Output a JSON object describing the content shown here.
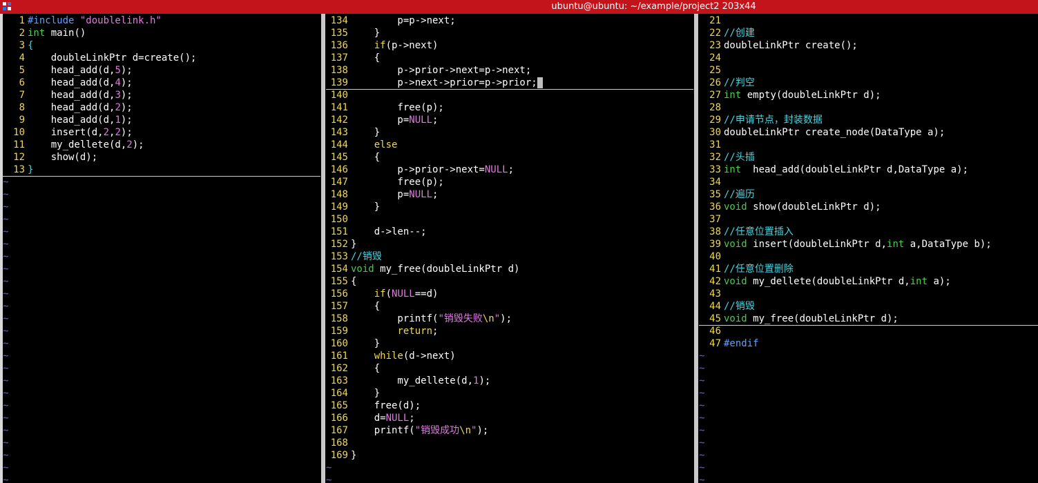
{
  "window": {
    "title": "ubuntu@ubuntu: ~/example/project2 203x44"
  },
  "colors": {
    "titlebar": "#c4141b",
    "background": "#000000",
    "line_number": "#f0d84e",
    "tilde": "#5f5ff0",
    "default": "#ffffff",
    "preproc": "#5fa0ff",
    "type": "#4ecb4e",
    "constant": "#e07be0",
    "statement": "#f0d84e",
    "comment": "#47d5e0",
    "operator": "#ffffff"
  },
  "panes": [
    {
      "name": "main-c",
      "lines": [
        {
          "n": "1",
          "segs": [
            {
              "t": "#include ",
              "c": "preproc"
            },
            {
              "t": "\"doublelink.h\"",
              "c": "constant"
            }
          ]
        },
        {
          "n": "2",
          "segs": [
            {
              "t": "int",
              "c": "type"
            },
            {
              "t": " main()",
              "c": "default"
            }
          ]
        },
        {
          "n": "3",
          "segs": [
            {
              "t": "{",
              "c": "comment"
            }
          ]
        },
        {
          "n": "4",
          "segs": [
            {
              "t": "    doubleLinkPtr d=create();",
              "c": "default"
            }
          ]
        },
        {
          "n": "5",
          "segs": [
            {
              "t": "    head_add(d,",
              "c": "default"
            },
            {
              "t": "5",
              "c": "constant"
            },
            {
              "t": ");",
              "c": "default"
            }
          ]
        },
        {
          "n": "6",
          "segs": [
            {
              "t": "    head_add(d,",
              "c": "default"
            },
            {
              "t": "4",
              "c": "constant"
            },
            {
              "t": ");",
              "c": "default"
            }
          ]
        },
        {
          "n": "7",
          "segs": [
            {
              "t": "    head_add(d,",
              "c": "default"
            },
            {
              "t": "3",
              "c": "constant"
            },
            {
              "t": ");",
              "c": "default"
            }
          ]
        },
        {
          "n": "8",
          "segs": [
            {
              "t": "    head_add(d,",
              "c": "default"
            },
            {
              "t": "2",
              "c": "constant"
            },
            {
              "t": ");",
              "c": "default"
            }
          ]
        },
        {
          "n": "9",
          "segs": [
            {
              "t": "    head_add(d,",
              "c": "default"
            },
            {
              "t": "1",
              "c": "constant"
            },
            {
              "t": ");",
              "c": "default"
            }
          ]
        },
        {
          "n": "10",
          "segs": [
            {
              "t": "    insert(d,",
              "c": "default"
            },
            {
              "t": "2",
              "c": "constant"
            },
            {
              "t": ",",
              "c": "default"
            },
            {
              "t": "2",
              "c": "constant"
            },
            {
              "t": ");",
              "c": "default"
            }
          ]
        },
        {
          "n": "11",
          "segs": [
            {
              "t": "    my_dellete(d,",
              "c": "default"
            },
            {
              "t": "2",
              "c": "constant"
            },
            {
              "t": ");",
              "c": "default"
            }
          ]
        },
        {
          "n": "12",
          "segs": [
            {
              "t": "    show(d);",
              "c": "default"
            }
          ]
        },
        {
          "n": "13",
          "segs": [
            {
              "t": "}",
              "c": "comment"
            }
          ],
          "current": true
        }
      ]
    },
    {
      "name": "doublelink-c",
      "lines": [
        {
          "n": "134",
          "segs": [
            {
              "t": "        p=p->next;",
              "c": "default"
            }
          ]
        },
        {
          "n": "135",
          "segs": [
            {
              "t": "    }",
              "c": "default"
            }
          ]
        },
        {
          "n": "136",
          "segs": [
            {
              "t": "    ",
              "c": "default"
            },
            {
              "t": "if",
              "c": "statement"
            },
            {
              "t": "(p->next)",
              "c": "default"
            }
          ]
        },
        {
          "n": "137",
          "segs": [
            {
              "t": "    {",
              "c": "default"
            }
          ]
        },
        {
          "n": "138",
          "segs": [
            {
              "t": "        p->prior->next=p->next;",
              "c": "default"
            }
          ]
        },
        {
          "n": "139",
          "segs": [
            {
              "t": "        p->next->prior=p->prior;",
              "c": "default"
            }
          ],
          "current": true,
          "cursor": true
        },
        {
          "n": "140",
          "segs": []
        },
        {
          "n": "141",
          "segs": [
            {
              "t": "        free(p);",
              "c": "default"
            }
          ]
        },
        {
          "n": "142",
          "segs": [
            {
              "t": "        p=",
              "c": "default"
            },
            {
              "t": "NULL",
              "c": "constant"
            },
            {
              "t": ";",
              "c": "default"
            }
          ]
        },
        {
          "n": "143",
          "segs": [
            {
              "t": "    }",
              "c": "default"
            }
          ]
        },
        {
          "n": "144",
          "segs": [
            {
              "t": "    ",
              "c": "default"
            },
            {
              "t": "else",
              "c": "statement"
            }
          ]
        },
        {
          "n": "145",
          "segs": [
            {
              "t": "    {",
              "c": "default"
            }
          ]
        },
        {
          "n": "146",
          "segs": [
            {
              "t": "        p->prior->next=",
              "c": "default"
            },
            {
              "t": "NULL",
              "c": "constant"
            },
            {
              "t": ";",
              "c": "default"
            }
          ]
        },
        {
          "n": "147",
          "segs": [
            {
              "t": "        free(p);",
              "c": "default"
            }
          ]
        },
        {
          "n": "148",
          "segs": [
            {
              "t": "        p=",
              "c": "default"
            },
            {
              "t": "NULL",
              "c": "constant"
            },
            {
              "t": ";",
              "c": "default"
            }
          ]
        },
        {
          "n": "149",
          "segs": [
            {
              "t": "    }",
              "c": "default"
            }
          ]
        },
        {
          "n": "150",
          "segs": []
        },
        {
          "n": "151",
          "segs": [
            {
              "t": "    d->len--;",
              "c": "default"
            }
          ]
        },
        {
          "n": "152",
          "segs": [
            {
              "t": "}",
              "c": "default"
            }
          ]
        },
        {
          "n": "153",
          "segs": [
            {
              "t": "//销毁",
              "c": "comment"
            }
          ]
        },
        {
          "n": "154",
          "segs": [
            {
              "t": "void",
              "c": "type"
            },
            {
              "t": " my_free(doubleLinkPtr d)",
              "c": "default"
            }
          ]
        },
        {
          "n": "155",
          "segs": [
            {
              "t": "{",
              "c": "default"
            }
          ]
        },
        {
          "n": "156",
          "segs": [
            {
              "t": "    ",
              "c": "default"
            },
            {
              "t": "if",
              "c": "statement"
            },
            {
              "t": "(",
              "c": "default"
            },
            {
              "t": "NULL",
              "c": "constant"
            },
            {
              "t": "==d)",
              "c": "default"
            }
          ]
        },
        {
          "n": "157",
          "segs": [
            {
              "t": "    {",
              "c": "default"
            }
          ]
        },
        {
          "n": "158",
          "segs": [
            {
              "t": "        printf(",
              "c": "default"
            },
            {
              "t": "\"销毁失败",
              "c": "constant"
            },
            {
              "t": "\\n",
              "c": "statement"
            },
            {
              "t": "\"",
              "c": "constant"
            },
            {
              "t": ");",
              "c": "default"
            }
          ]
        },
        {
          "n": "159",
          "segs": [
            {
              "t": "        ",
              "c": "default"
            },
            {
              "t": "return",
              "c": "statement"
            },
            {
              "t": ";",
              "c": "default"
            }
          ]
        },
        {
          "n": "160",
          "segs": [
            {
              "t": "    }",
              "c": "default"
            }
          ]
        },
        {
          "n": "161",
          "segs": [
            {
              "t": "    ",
              "c": "default"
            },
            {
              "t": "while",
              "c": "statement"
            },
            {
              "t": "(d->next)",
              "c": "default"
            }
          ]
        },
        {
          "n": "162",
          "segs": [
            {
              "t": "    {",
              "c": "default"
            }
          ]
        },
        {
          "n": "163",
          "segs": [
            {
              "t": "        my_dellete(d,",
              "c": "default"
            },
            {
              "t": "1",
              "c": "constant"
            },
            {
              "t": ");",
              "c": "default"
            }
          ]
        },
        {
          "n": "164",
          "segs": [
            {
              "t": "    }",
              "c": "default"
            }
          ]
        },
        {
          "n": "165",
          "segs": [
            {
              "t": "    free(d);",
              "c": "default"
            }
          ]
        },
        {
          "n": "166",
          "segs": [
            {
              "t": "    d=",
              "c": "default"
            },
            {
              "t": "NULL",
              "c": "constant"
            },
            {
              "t": ";",
              "c": "default"
            }
          ]
        },
        {
          "n": "167",
          "segs": [
            {
              "t": "    printf(",
              "c": "default"
            },
            {
              "t": "\"销毁成功",
              "c": "constant"
            },
            {
              "t": "\\n",
              "c": "statement"
            },
            {
              "t": "\"",
              "c": "constant"
            },
            {
              "t": ");",
              "c": "default"
            }
          ]
        },
        {
          "n": "168",
          "segs": []
        },
        {
          "n": "169",
          "segs": [
            {
              "t": "}",
              "c": "default"
            }
          ]
        }
      ]
    },
    {
      "name": "doublelink-h",
      "lines": [
        {
          "n": "21",
          "segs": []
        },
        {
          "n": "22",
          "segs": [
            {
              "t": "//创建",
              "c": "comment"
            }
          ]
        },
        {
          "n": "23",
          "segs": [
            {
              "t": "doubleLinkPtr create();",
              "c": "default"
            }
          ]
        },
        {
          "n": "24",
          "segs": []
        },
        {
          "n": "25",
          "segs": []
        },
        {
          "n": "26",
          "segs": [
            {
              "t": "//判空",
              "c": "comment"
            }
          ]
        },
        {
          "n": "27",
          "segs": [
            {
              "t": "int",
              "c": "type"
            },
            {
              "t": " empty(doubleLinkPtr d);",
              "c": "default"
            }
          ]
        },
        {
          "n": "28",
          "segs": []
        },
        {
          "n": "29",
          "segs": [
            {
              "t": "//申请节点，封装数据",
              "c": "comment"
            }
          ]
        },
        {
          "n": "30",
          "segs": [
            {
              "t": "doubleLinkPtr create_node(DataType a);",
              "c": "default"
            }
          ]
        },
        {
          "n": "31",
          "segs": []
        },
        {
          "n": "32",
          "segs": [
            {
              "t": "//头插",
              "c": "comment"
            }
          ]
        },
        {
          "n": "33",
          "segs": [
            {
              "t": "int",
              "c": "type"
            },
            {
              "t": "  head_add(doubleLinkPtr d,DataType a);",
              "c": "default"
            }
          ]
        },
        {
          "n": "34",
          "segs": []
        },
        {
          "n": "35",
          "segs": [
            {
              "t": "//遍历",
              "c": "comment"
            }
          ]
        },
        {
          "n": "36",
          "segs": [
            {
              "t": "void",
              "c": "type"
            },
            {
              "t": " show(doubleLinkPtr d);",
              "c": "default"
            }
          ]
        },
        {
          "n": "37",
          "segs": []
        },
        {
          "n": "38",
          "segs": [
            {
              "t": "//任意位置插入",
              "c": "comment"
            }
          ]
        },
        {
          "n": "39",
          "segs": [
            {
              "t": "void",
              "c": "type"
            },
            {
              "t": " insert(doubleLinkPtr d,",
              "c": "default"
            },
            {
              "t": "int",
              "c": "type"
            },
            {
              "t": " a,DataType b);",
              "c": "default"
            }
          ]
        },
        {
          "n": "40",
          "segs": []
        },
        {
          "n": "41",
          "segs": [
            {
              "t": "//任意位置删除",
              "c": "comment"
            }
          ]
        },
        {
          "n": "42",
          "segs": [
            {
              "t": "void",
              "c": "type"
            },
            {
              "t": " my_dellete(doubleLinkPtr d,",
              "c": "default"
            },
            {
              "t": "int",
              "c": "type"
            },
            {
              "t": " a);",
              "c": "default"
            }
          ]
        },
        {
          "n": "43",
          "segs": []
        },
        {
          "n": "44",
          "segs": [
            {
              "t": "//销毁",
              "c": "comment"
            }
          ]
        },
        {
          "n": "45",
          "segs": [
            {
              "t": "void",
              "c": "type"
            },
            {
              "t": " my_free(doubleLinkPtr d);",
              "c": "default"
            }
          ],
          "current": true
        },
        {
          "n": "46",
          "segs": []
        },
        {
          "n": "47",
          "segs": [
            {
              "t": "#endif",
              "c": "preproc"
            }
          ]
        }
      ]
    }
  ],
  "empty_marker": "~"
}
